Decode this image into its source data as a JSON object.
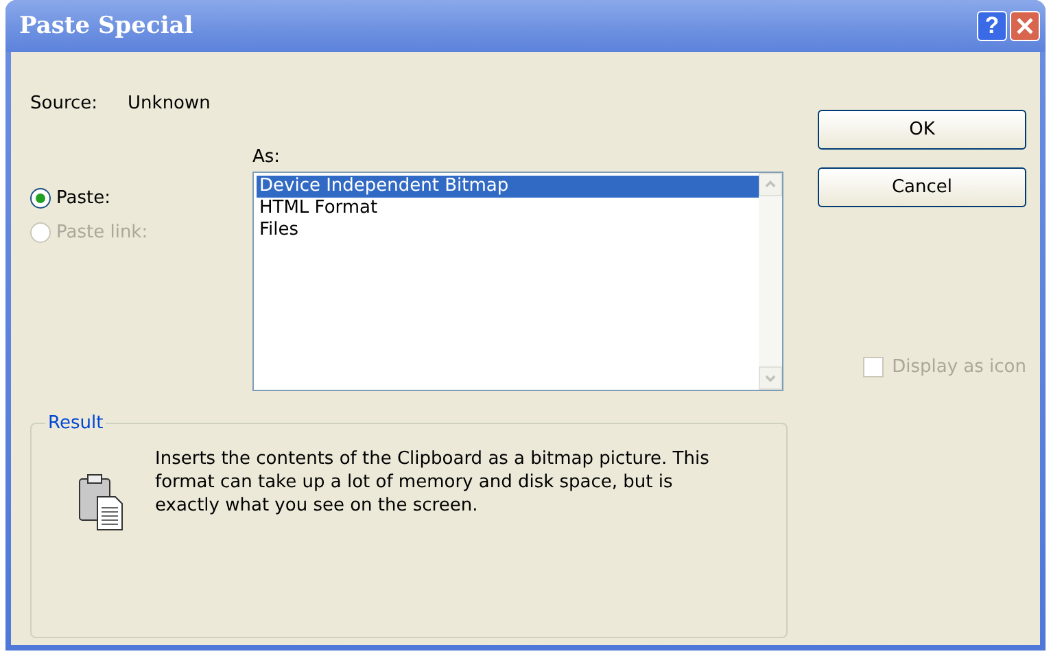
{
  "window": {
    "title": "Paste Special",
    "help": "?"
  },
  "source": {
    "label": "Source:",
    "value": "Unknown"
  },
  "options": [
    {
      "label": "Paste:",
      "selected": true,
      "disabled": false
    },
    {
      "label": "Paste link:",
      "selected": false,
      "disabled": true
    }
  ],
  "as_list": {
    "label": "As:",
    "items": [
      {
        "label": "Device Independent Bitmap",
        "selected": true
      },
      {
        "label": "HTML Format",
        "selected": false
      },
      {
        "label": "Files",
        "selected": false
      }
    ]
  },
  "buttons": [
    "OK",
    "Cancel"
  ],
  "display_as_icon": {
    "label": "Display as icon",
    "checked": false,
    "disabled": true
  },
  "result": {
    "title": "Result",
    "text": "Inserts the contents of the Clipboard as a bitmap picture. This format can take up a lot of memory and disk space, but is exactly what you see on the screen."
  }
}
